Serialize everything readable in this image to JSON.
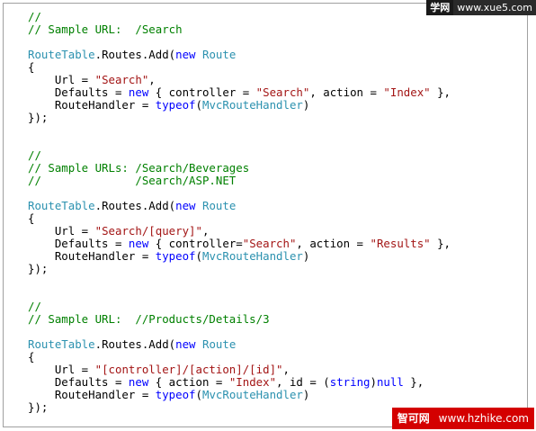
{
  "code_lines": [
    [
      {
        "t": "//",
        "c": "comment"
      }
    ],
    [
      {
        "t": "// Sample URL:  /Search",
        "c": "comment"
      }
    ],
    [
      {
        "t": "",
        "c": "plain"
      }
    ],
    [
      {
        "t": "RouteTable",
        "c": "type"
      },
      {
        "t": ".Routes.Add(",
        "c": "plain"
      },
      {
        "t": "new",
        "c": "keyword"
      },
      {
        "t": " ",
        "c": "plain"
      },
      {
        "t": "Route",
        "c": "type"
      }
    ],
    [
      {
        "t": "{",
        "c": "plain"
      }
    ],
    [
      {
        "t": "    Url = ",
        "c": "plain"
      },
      {
        "t": "\"Search\"",
        "c": "string"
      },
      {
        "t": ",",
        "c": "plain"
      }
    ],
    [
      {
        "t": "    Defaults = ",
        "c": "plain"
      },
      {
        "t": "new",
        "c": "keyword"
      },
      {
        "t": " { controller = ",
        "c": "plain"
      },
      {
        "t": "\"Search\"",
        "c": "string"
      },
      {
        "t": ", action = ",
        "c": "plain"
      },
      {
        "t": "\"Index\"",
        "c": "string"
      },
      {
        "t": " },",
        "c": "plain"
      }
    ],
    [
      {
        "t": "    RouteHandler = ",
        "c": "plain"
      },
      {
        "t": "typeof",
        "c": "keyword"
      },
      {
        "t": "(",
        "c": "plain"
      },
      {
        "t": "MvcRouteHandler",
        "c": "type"
      },
      {
        "t": ")",
        "c": "plain"
      }
    ],
    [
      {
        "t": "});",
        "c": "plain"
      }
    ],
    [
      {
        "t": "",
        "c": "plain"
      }
    ],
    [
      {
        "t": "",
        "c": "plain"
      }
    ],
    [
      {
        "t": "//",
        "c": "comment"
      }
    ],
    [
      {
        "t": "// Sample URLs: /Search/Beverages",
        "c": "comment"
      }
    ],
    [
      {
        "t": "//              /Search/ASP.NET",
        "c": "comment"
      }
    ],
    [
      {
        "t": "",
        "c": "plain"
      }
    ],
    [
      {
        "t": "RouteTable",
        "c": "type"
      },
      {
        "t": ".Routes.Add(",
        "c": "plain"
      },
      {
        "t": "new",
        "c": "keyword"
      },
      {
        "t": " ",
        "c": "plain"
      },
      {
        "t": "Route",
        "c": "type"
      }
    ],
    [
      {
        "t": "{",
        "c": "plain"
      }
    ],
    [
      {
        "t": "    Url = ",
        "c": "plain"
      },
      {
        "t": "\"Search/[query]\"",
        "c": "string"
      },
      {
        "t": ",",
        "c": "plain"
      }
    ],
    [
      {
        "t": "    Defaults = ",
        "c": "plain"
      },
      {
        "t": "new",
        "c": "keyword"
      },
      {
        "t": " { controller=",
        "c": "plain"
      },
      {
        "t": "\"Search\"",
        "c": "string"
      },
      {
        "t": ", action = ",
        "c": "plain"
      },
      {
        "t": "\"Results\"",
        "c": "string"
      },
      {
        "t": " },",
        "c": "plain"
      }
    ],
    [
      {
        "t": "    RouteHandler = ",
        "c": "plain"
      },
      {
        "t": "typeof",
        "c": "keyword"
      },
      {
        "t": "(",
        "c": "plain"
      },
      {
        "t": "MvcRouteHandler",
        "c": "type"
      },
      {
        "t": ")",
        "c": "plain"
      }
    ],
    [
      {
        "t": "});",
        "c": "plain"
      }
    ],
    [
      {
        "t": "",
        "c": "plain"
      }
    ],
    [
      {
        "t": "",
        "c": "plain"
      }
    ],
    [
      {
        "t": "//",
        "c": "comment"
      }
    ],
    [
      {
        "t": "// Sample URL:  //Products/Details/3",
        "c": "comment"
      }
    ],
    [
      {
        "t": "",
        "c": "plain"
      }
    ],
    [
      {
        "t": "RouteTable",
        "c": "type"
      },
      {
        "t": ".Routes.Add(",
        "c": "plain"
      },
      {
        "t": "new",
        "c": "keyword"
      },
      {
        "t": " ",
        "c": "plain"
      },
      {
        "t": "Route",
        "c": "type"
      }
    ],
    [
      {
        "t": "{",
        "c": "plain"
      }
    ],
    [
      {
        "t": "    Url = ",
        "c": "plain"
      },
      {
        "t": "\"[controller]/[action]/[id]\"",
        "c": "string"
      },
      {
        "t": ",",
        "c": "plain"
      }
    ],
    [
      {
        "t": "    Defaults = ",
        "c": "plain"
      },
      {
        "t": "new",
        "c": "keyword"
      },
      {
        "t": " { action = ",
        "c": "plain"
      },
      {
        "t": "\"Index\"",
        "c": "string"
      },
      {
        "t": ", id = (",
        "c": "plain"
      },
      {
        "t": "string",
        "c": "keyword"
      },
      {
        "t": ")",
        "c": "plain"
      },
      {
        "t": "null",
        "c": "keyword"
      },
      {
        "t": " },",
        "c": "plain"
      }
    ],
    [
      {
        "t": "    RouteHandler = ",
        "c": "plain"
      },
      {
        "t": "typeof",
        "c": "keyword"
      },
      {
        "t": "(",
        "c": "plain"
      },
      {
        "t": "MvcRouteHandler",
        "c": "type"
      },
      {
        "t": ")",
        "c": "plain"
      }
    ],
    [
      {
        "t": "});",
        "c": "plain"
      }
    ]
  ],
  "colors": {
    "comment": "#008000",
    "keyword": "#0000ff",
    "type": "#2b91af",
    "string": "#a31515",
    "plain": "#000000",
    "frame_border": "#a0a0a0",
    "watermark_red": "#d40000"
  },
  "watermark_top": {
    "logo": "学网",
    "url": "www.xue5.com"
  },
  "watermark_bottom": {
    "name": "智可网",
    "url": "www.hzhike.com"
  }
}
